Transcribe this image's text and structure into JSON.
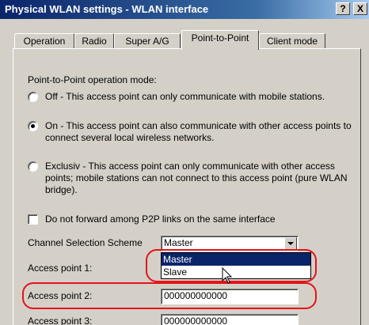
{
  "window": {
    "title": "Physical WLAN settings - WLAN interface",
    "help_label": "?",
    "close_label": "X"
  },
  "tabs": [
    {
      "label": "Operation",
      "active": false
    },
    {
      "label": "Radio",
      "active": false
    },
    {
      "label": "Super A/G",
      "active": false
    },
    {
      "label": "Point-to-Point",
      "active": true
    },
    {
      "label": "Client mode",
      "active": false
    }
  ],
  "p2p": {
    "mode_heading": "Point-to-Point operation mode:",
    "options": [
      {
        "label": "Off - This access point can only communicate with mobile stations.",
        "selected": false
      },
      {
        "label": "On - This access point can also communicate with other access points to connect several local wireless networks.",
        "selected": true
      },
      {
        "label": "Exclusiv - This access point can only communicate with other access points; mobile stations can not connect to this access point (pure WLAN bridge).",
        "selected": false
      }
    ],
    "no_forward_label": "Do not forward among P2P links on the same interface",
    "no_forward_checked": false,
    "channel_scheme_label": "Channel Selection Scheme",
    "channel_scheme_value": "Master",
    "channel_scheme_options": [
      "Master",
      "Slave"
    ],
    "access_points": [
      {
        "label": "Access point 1:",
        "value": ""
      },
      {
        "label": "Access point 2:",
        "value": "000000000000"
      },
      {
        "label": "Access point 3:",
        "value": "000000000000"
      }
    ]
  },
  "colors": {
    "titlebar_start": "#0a246a",
    "titlebar_end": "#a6caf0",
    "highlight": "#0a246a",
    "annotation": "#e3141b",
    "face": "#d4d0c8"
  }
}
